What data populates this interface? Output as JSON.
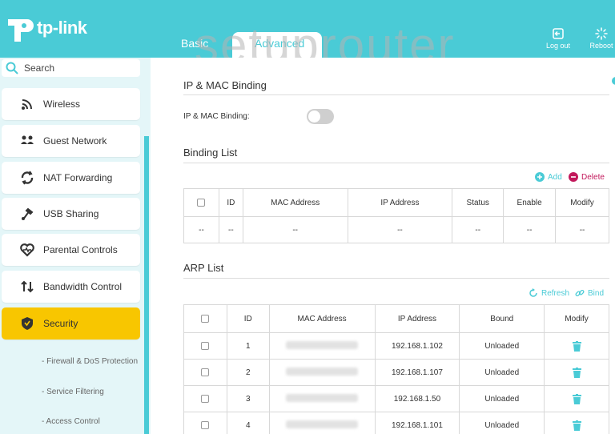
{
  "brand": {
    "name": "tp-link",
    "accent": "#4acbd6",
    "highlight": "#f8c600"
  },
  "watermark": "setuprouter",
  "top_nav": {
    "basic": "Basic",
    "advanced": "Advanced"
  },
  "top_actions": {
    "logout": "Log out",
    "reboot": "Reboot"
  },
  "search": {
    "placeholder": "Search"
  },
  "sidebar": {
    "items": [
      {
        "label": "Wireless",
        "icon": "wifi-icon"
      },
      {
        "label": "Guest Network",
        "icon": "guest-icon"
      },
      {
        "label": "NAT Forwarding",
        "icon": "nat-icon"
      },
      {
        "label": "USB Sharing",
        "icon": "usb-icon"
      },
      {
        "label": "Parental Controls",
        "icon": "heart-icon"
      },
      {
        "label": "Bandwidth Control",
        "icon": "bandwidth-icon"
      },
      {
        "label": "Security",
        "icon": "shield-icon"
      }
    ],
    "sub_items": [
      "- Firewall & DoS Protection",
      "- Service Filtering",
      "- Access Control"
    ]
  },
  "binding": {
    "title": "IP & MAC Binding",
    "toggle_label": "IP & MAC Binding:",
    "toggle_on": false
  },
  "binding_list": {
    "title": "Binding List",
    "add": "Add",
    "delete": "Delete",
    "headers": [
      "ID",
      "MAC Address",
      "IP Address",
      "Status",
      "Enable",
      "Modify"
    ],
    "row": [
      "--",
      "--",
      "--",
      "--",
      "--",
      "--",
      "--"
    ]
  },
  "arp_list": {
    "title": "ARP List",
    "refresh": "Refresh",
    "bind": "Bind",
    "headers": [
      "ID",
      "MAC Address",
      "IP Address",
      "Bound",
      "Modify"
    ],
    "rows": [
      {
        "id": "1",
        "ip": "192.168.1.102",
        "bound": "Unloaded"
      },
      {
        "id": "2",
        "ip": "192.168.1.107",
        "bound": "Unloaded"
      },
      {
        "id": "3",
        "ip": "192.168.1.50",
        "bound": "Unloaded"
      },
      {
        "id": "4",
        "ip": "192.168.1.101",
        "bound": "Unloaded"
      }
    ]
  }
}
